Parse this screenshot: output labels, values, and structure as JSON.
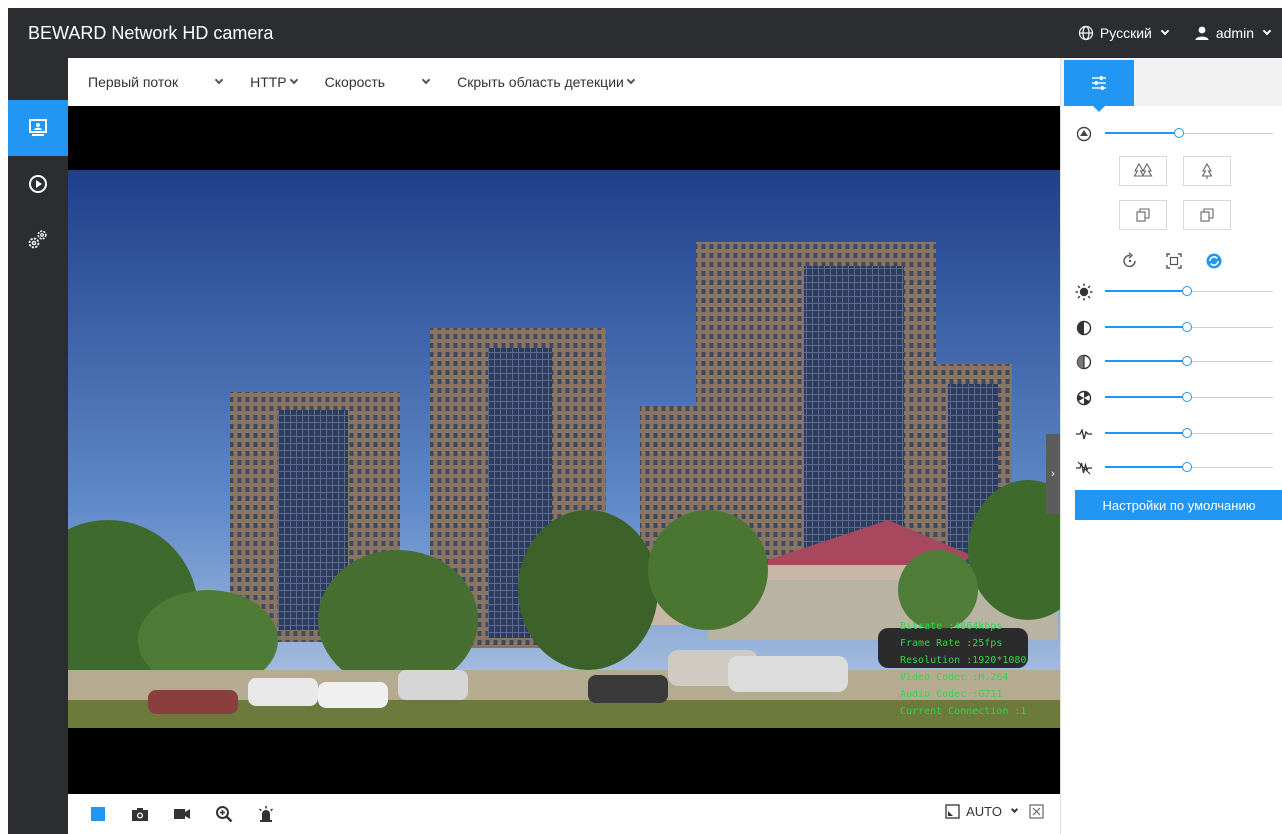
{
  "header": {
    "title": "BEWARD Network HD camera",
    "language": "Русский",
    "user": "admin"
  },
  "nav": [
    {
      "name": "live-view",
      "icon": "monitor-icon"
    },
    {
      "name": "playback",
      "icon": "play-circle-icon"
    },
    {
      "name": "settings",
      "icon": "gears-icon"
    }
  ],
  "toolbar": {
    "stream": "Первый поток",
    "protocol": "HTTP",
    "mode": "Скорость",
    "detection": "Скрыть область детекции"
  },
  "osd": {
    "bitrate": "Bitrate :4864kbps",
    "frame_rate": "Frame Rate :25fps",
    "resolution": "Resolution :1920*1080",
    "video_codec": "Video Codec :H.264",
    "audio_codec": "Audio Codec :G711",
    "connections": "Current Connection :1"
  },
  "bottombar": {
    "zoom_mode": "AUTO"
  },
  "panel": {
    "sliders": [
      {
        "name": "exposure",
        "icon": "exposure-icon",
        "value": 0.44
      },
      {
        "name": "brightness",
        "icon": "sun-icon",
        "value": 0.49
      },
      {
        "name": "contrast",
        "icon": "contrast-icon",
        "value": 0.49
      },
      {
        "name": "saturation",
        "icon": "saturation-icon",
        "value": 0.49
      },
      {
        "name": "hue",
        "icon": "hue-icon",
        "value": 0.49
      },
      {
        "name": "sharpness",
        "icon": "sharpness-icon",
        "value": 0.49
      },
      {
        "name": "noise-reduction",
        "icon": "noise-icon",
        "value": 0.49
      }
    ],
    "default_label": "Настройки по умолчанию"
  },
  "colors": {
    "accent": "#2196f3",
    "header_bg": "#2b2d31",
    "osd_text": "#2bd94a"
  }
}
